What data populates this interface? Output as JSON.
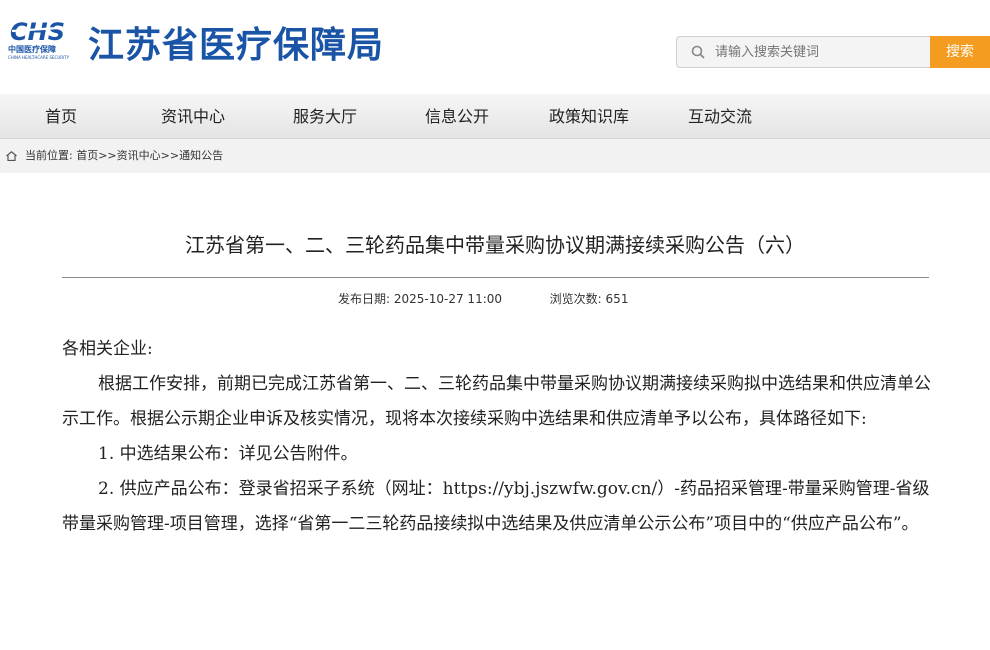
{
  "header": {
    "logo_mark": "CHS",
    "logo_cn": "中国医疗保障",
    "logo_en": "CHINA HEALTHCARE SECURITY",
    "site_title": "江苏省医疗保障局"
  },
  "search": {
    "placeholder": "请输入搜索关键词",
    "button_label": "搜索"
  },
  "nav": {
    "items": [
      {
        "label": "首页"
      },
      {
        "label": "资讯中心"
      },
      {
        "label": "服务大厅"
      },
      {
        "label": "信息公开"
      },
      {
        "label": "政策知识库"
      },
      {
        "label": "互动交流"
      }
    ]
  },
  "breadcrumb": {
    "prefix": "当前位置:",
    "items": [
      "首页",
      "资讯中心",
      "通知公告"
    ],
    "separator": ">>"
  },
  "article": {
    "title": "江苏省第一、二、三轮药品集中带量采购协议期满接续采购公告（六）",
    "date_label": "发布日期:",
    "date_value": "2025-10-27 11:00",
    "views_label": "浏览次数:",
    "views_value": "651",
    "salutation": "各相关企业:",
    "paragraph1": "根据工作安排，前期已完成江苏省第一、二、三轮药品集中带量采购协议期满接续采购拟中选结果和供应清单公示工作。根据公示期企业申诉及核实情况，现将本次接续采购中选结果和供应清单予以公布，具体路径如下:",
    "item1": "1. 中选结果公布：详见公告附件。",
    "item2": "2. 供应产品公布：登录省招采子系统（网址：https://ybj.jszwfw.gov.cn/）-药品招采管理-带量采购管理-省级带量采购管理-项目管理，选择“省第一二三轮药品接续拟中选结果及供应清单公示公布”项目中的“供应产品公布”。"
  },
  "colors": {
    "brand_blue": "#1a54a6",
    "search_orange": "#f39c1f"
  }
}
